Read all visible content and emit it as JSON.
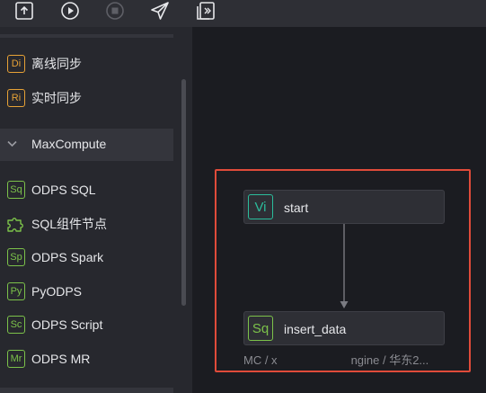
{
  "sidebar": {
    "items": [
      {
        "badge": "Di",
        "label": "离线同步"
      },
      {
        "badge": "Ri",
        "label": "实时同步"
      }
    ],
    "group": {
      "label": "MaxCompute"
    },
    "children": [
      {
        "badge": "Sq",
        "label": "ODPS SQL"
      },
      {
        "badge": "",
        "label": "SQL组件节点"
      },
      {
        "badge": "Sp",
        "label": "ODPS Spark"
      },
      {
        "badge": "Py",
        "label": "PyODPS"
      },
      {
        "badge": "Sc",
        "label": "ODPS Script"
      },
      {
        "badge": "Mr",
        "label": "ODPS MR"
      }
    ]
  },
  "canvas": {
    "nodes": [
      {
        "badge": "Vi",
        "label": "start"
      },
      {
        "badge": "Sq",
        "label": "insert_data"
      }
    ],
    "node_path_prefix": "MC / x",
    "node_path_suffix": "ngine / 华东2..."
  },
  "colors": {
    "accent_red": "#e04b3a",
    "orange": "#e7a236",
    "green": "#7cc24a",
    "teal": "#2bbd9c"
  },
  "icons": {
    "toolbar": [
      "upload-icon",
      "play-icon",
      "stop-icon",
      "send-icon",
      "export-icon"
    ],
    "group_expand": "chevron-down-icon",
    "sql_component": "puzzle-icon"
  }
}
